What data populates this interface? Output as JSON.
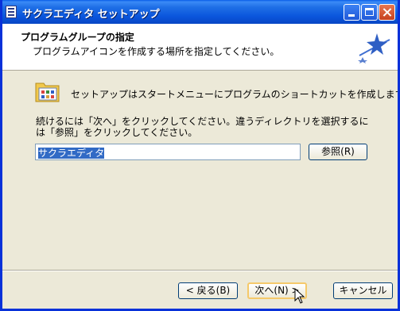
{
  "window": {
    "title": "サクラエディタ セットアップ"
  },
  "header": {
    "title": "プログラムグループの指定",
    "subtitle": "プログラムアイコンを作成する場所を指定してください。"
  },
  "body": {
    "intro": "セットアップはスタートメニューにプログラムのショートカットを作成します。",
    "instruction": "続けるには「次へ」をクリックしてください。違うディレクトリを選択するには「参照」をクリックしてください。",
    "folder_value": "サクラエディタ",
    "browse_label": "参照(R)"
  },
  "footer": {
    "back_label": "< 戻る(B)",
    "next_label": "次へ(N) >",
    "cancel_label": "キャンセル"
  },
  "icons": {
    "app": "setup-app-icon",
    "logo": "wizard-star-logo",
    "folder": "program-folder-icon"
  }
}
